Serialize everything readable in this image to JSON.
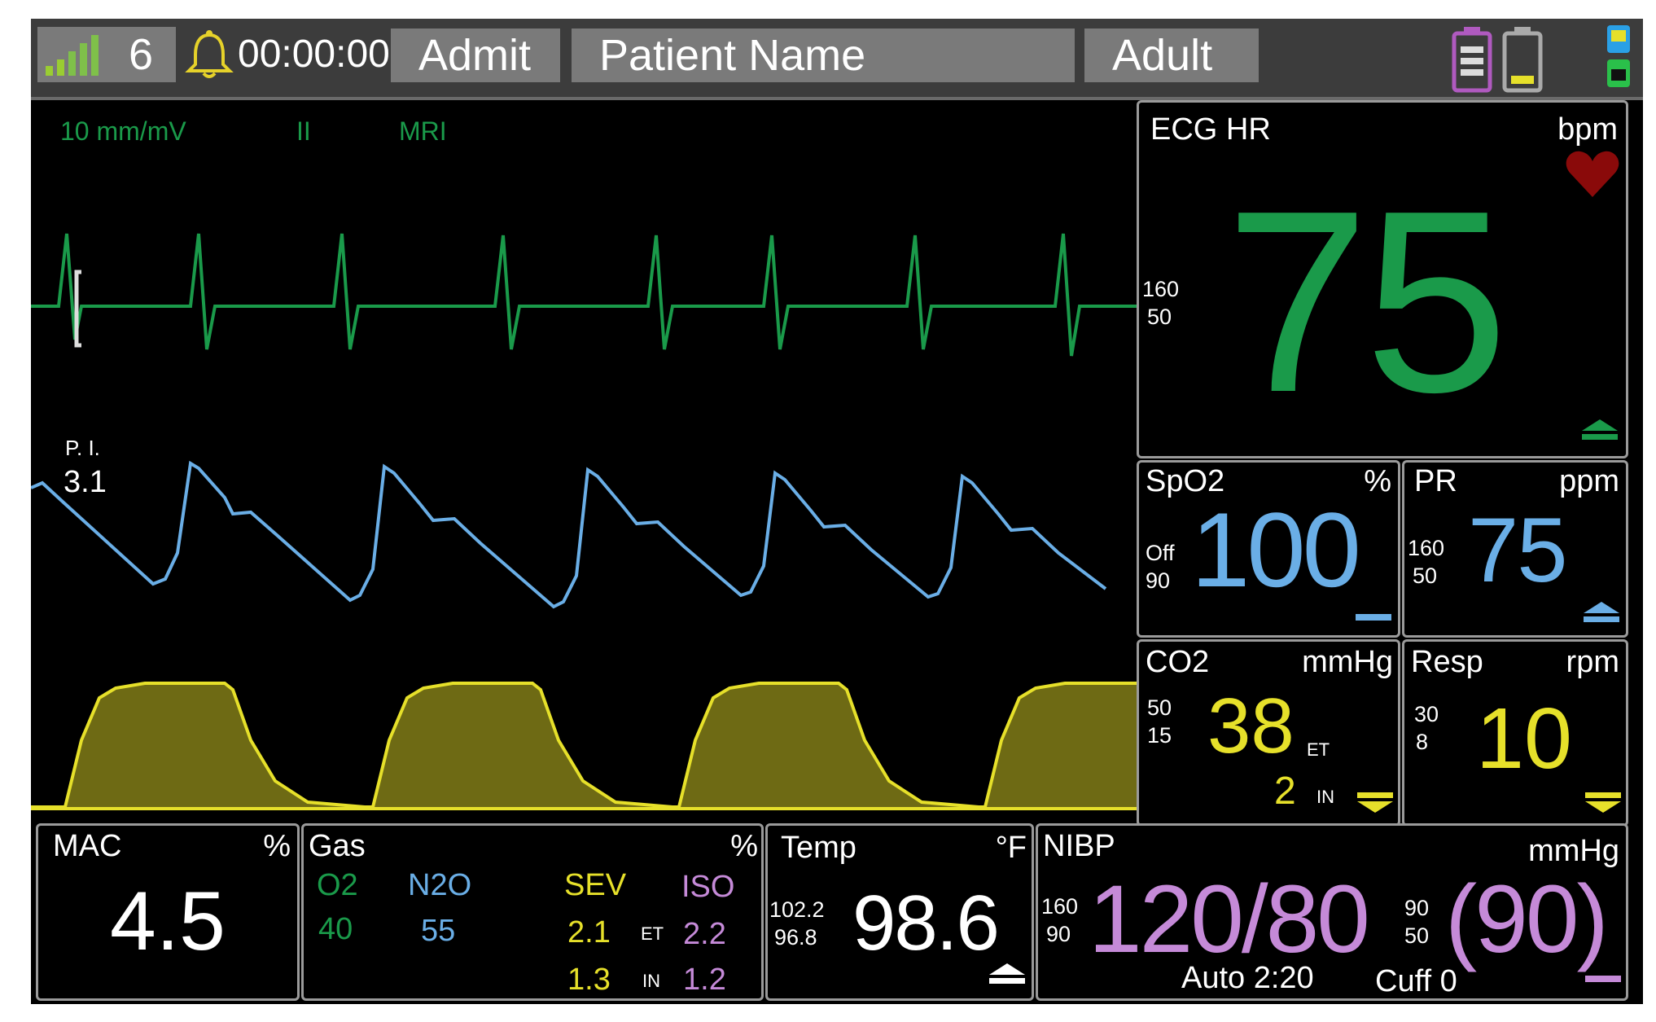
{
  "colors": {
    "ecg": "#1a9a4a",
    "spo2": "#6aaee6",
    "co2": "#e6e02a",
    "nibp": "#c58ad8",
    "bar": "#3c3c3c",
    "heart": "#8a0a0a"
  },
  "topbar": {
    "signal_icon": "signal-bars-icon",
    "signal_count": "6",
    "alarm_icon": "alarm-bell-icon",
    "timer": "00:00:00",
    "admit_label": "Admit",
    "patient_name": "Patient Name",
    "patient_type": "Adult",
    "battery_icons": [
      "battery-icon",
      "battery-icon"
    ],
    "status_icon": "status-indicator-icon"
  },
  "ecg_wave": {
    "gain": "10 mm/mV",
    "lead": "II",
    "filter": "MRI"
  },
  "pleth_wave": {
    "pi_label": "P. I.",
    "pi_value": "3.1"
  },
  "ecg_hr": {
    "label": "ECG HR",
    "unit": "bpm",
    "value": "75",
    "limit_high": "160",
    "limit_low": "50",
    "heart_icon": "heart-icon"
  },
  "spo2": {
    "label": "SpO2",
    "unit": "%",
    "value": "100",
    "limit_high": "Off",
    "limit_low": "90"
  },
  "pr": {
    "label": "PR",
    "unit": "ppm",
    "value": "75",
    "limit_high": "160",
    "limit_low": "50"
  },
  "co2": {
    "label": "CO2",
    "unit": "mmHg",
    "et_value": "38",
    "et_label": "ET",
    "in_value": "2",
    "in_label": "IN",
    "limit_high": "50",
    "limit_low": "15"
  },
  "resp": {
    "label": "Resp",
    "unit": "rpm",
    "value": "10",
    "limit_high": "30",
    "limit_low": "8"
  },
  "mac": {
    "label": "MAC",
    "unit": "%",
    "value": "4.5"
  },
  "gas": {
    "label": "Gas",
    "unit": "%",
    "o2_label": "O2",
    "o2_value": "40",
    "n2o_label": "N2O",
    "n2o_value": "55",
    "sev_label": "SEV",
    "sev_et": "2.1",
    "sev_in": "1.3",
    "iso_label": "ISO",
    "iso_et": "2.2",
    "iso_in": "1.2",
    "et_label": "ET",
    "in_label": "IN"
  },
  "temp": {
    "label": "Temp",
    "unit": "°F",
    "value": "98.6",
    "limit_high": "102.2",
    "limit_low": "96.8"
  },
  "nibp": {
    "label": "NIBP",
    "unit": "mmHg",
    "value": "120/80",
    "mean": "(90)",
    "limit_high": "160",
    "limit_low": "90",
    "mean_limit_high": "90",
    "mean_limit_low": "50",
    "mode": "Auto 2:20",
    "cuff": "Cuff 0"
  }
}
